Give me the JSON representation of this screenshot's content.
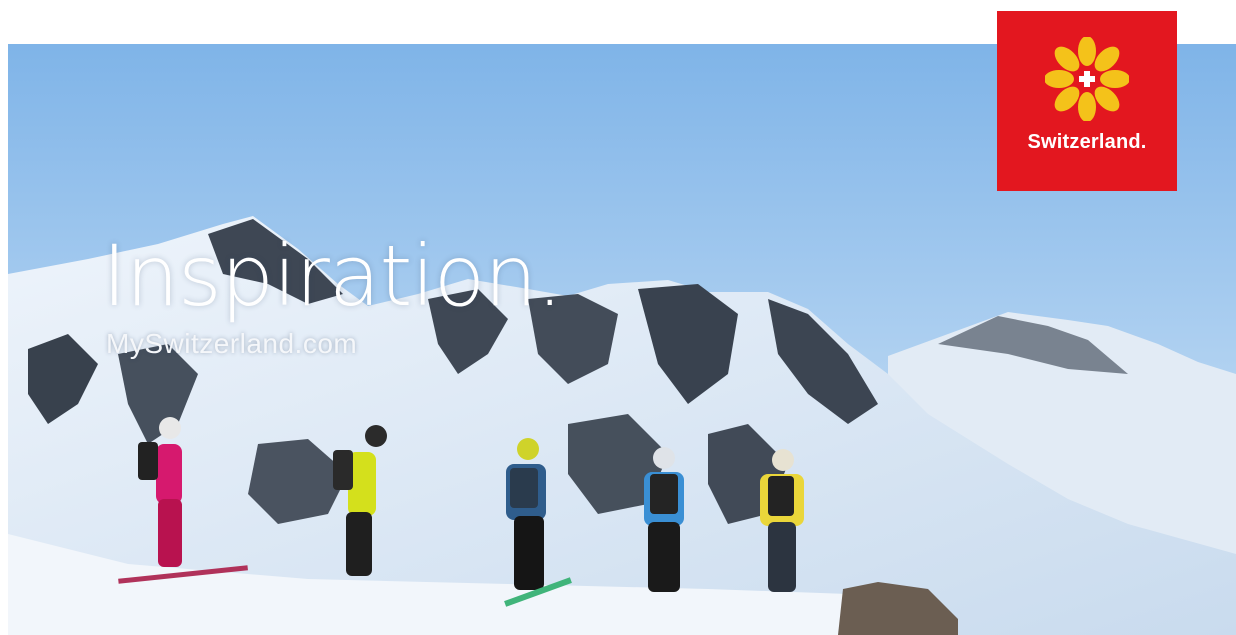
{
  "ad": {
    "headline": "Inspiration.",
    "url": "MySwitzerland.com",
    "logo_text": "Switzerland."
  },
  "colors": {
    "brand_red": "#e3171f",
    "sky_top": "#7fb4e8",
    "sky_bottom": "#d8e9f8"
  },
  "icons": {
    "logo_mark": "edelweiss-swiss-cross-icon"
  }
}
